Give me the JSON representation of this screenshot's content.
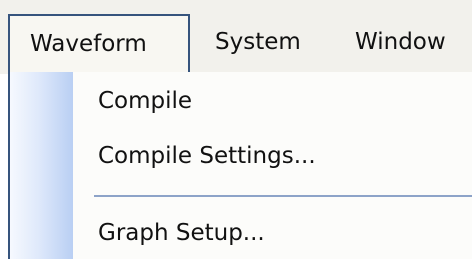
{
  "menubar": {
    "items": [
      {
        "label": "Waveform",
        "active": true
      },
      {
        "label": "System"
      },
      {
        "label": "Window"
      }
    ]
  },
  "dropdown": {
    "items": [
      {
        "label": "Compile"
      },
      {
        "label": "Compile Settings..."
      },
      {
        "separator": true
      },
      {
        "label": "Graph Setup..."
      }
    ]
  },
  "colors": {
    "active_border": "#36547d",
    "gutter_blue": "#b9cff3",
    "separator": "#8da3c8"
  }
}
